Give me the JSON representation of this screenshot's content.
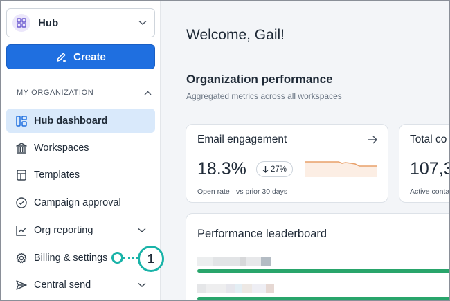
{
  "sidebar": {
    "hub_select": {
      "label": "Hub"
    },
    "create_button": {
      "label": "Create"
    },
    "section_title": "MY ORGANIZATION",
    "items": [
      {
        "label": "Hub dashboard",
        "icon": "dashboard-icon",
        "active": true
      },
      {
        "label": "Workspaces",
        "icon": "building-icon"
      },
      {
        "label": "Templates",
        "icon": "template-icon"
      },
      {
        "label": "Campaign approval",
        "icon": "check-circle-icon"
      },
      {
        "label": "Org reporting",
        "icon": "chart-icon",
        "expandable": true
      },
      {
        "label": "Billing & settings",
        "icon": "gear-icon"
      },
      {
        "label": "Central send",
        "icon": "send-icon",
        "expandable": true
      }
    ]
  },
  "callout": {
    "number": "1",
    "color": "#19b3a8"
  },
  "main": {
    "welcome": "Welcome, Gail!",
    "org_title": "Organization performance",
    "org_subtitle": "Aggregated metrics across all workspaces",
    "email_card": {
      "title": "Email engagement",
      "value": "18.3%",
      "delta": "27%",
      "footnote": "Open rate · vs prior 30 days"
    },
    "total_card": {
      "title": "Total co",
      "value": "107,3",
      "footnote": "Active conta"
    },
    "leaderboard": {
      "title": "Performance leaderboard"
    }
  },
  "colors": {
    "accent": "#1f6fe0",
    "active_bg": "#d9e9fb",
    "spark_line": "#e8a06a",
    "progress": "#29a56b"
  }
}
